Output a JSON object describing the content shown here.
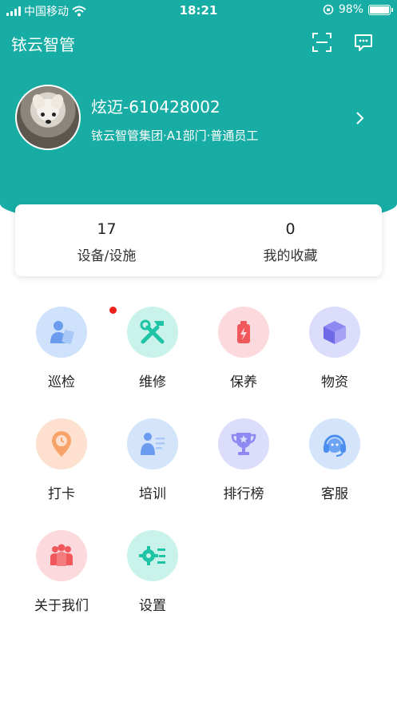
{
  "status_bar": {
    "carrier": "中国移动",
    "time": "18:21",
    "battery": "98%",
    "battery_level": 0.98
  },
  "header": {
    "title": "铱云智管"
  },
  "profile": {
    "name": "炫迈-610428002",
    "org": "铱云智管集团·A1部门·普通员工"
  },
  "stats": [
    {
      "value": "17",
      "label": "设备/设施"
    },
    {
      "value": "0",
      "label": "我的收藏"
    }
  ],
  "menu": [
    {
      "label": "巡检",
      "icon": "inspection-icon",
      "color": "#cfe2fb",
      "badge": true
    },
    {
      "label": "维修",
      "icon": "repair-tools-icon",
      "color": "#c9f3ea"
    },
    {
      "label": "保养",
      "icon": "battery-maintenance-icon",
      "color": "#fbd9dc"
    },
    {
      "label": "物资",
      "icon": "package-box-icon",
      "color": "#dcdcfb"
    },
    {
      "label": "打卡",
      "icon": "clock-pin-icon",
      "color": "#fde0cf"
    },
    {
      "label": "培训",
      "icon": "training-person-icon",
      "color": "#d3e4fb"
    },
    {
      "label": "排行榜",
      "icon": "trophy-icon",
      "color": "#dcdcfb"
    },
    {
      "label": "客服",
      "icon": "headset-icon",
      "color": "#d3e4fb"
    },
    {
      "label": "关于我们",
      "icon": "team-people-icon",
      "color": "#fbd9dc"
    },
    {
      "label": "设置",
      "icon": "gear-settings-icon",
      "color": "#c9f3ea"
    }
  ]
}
